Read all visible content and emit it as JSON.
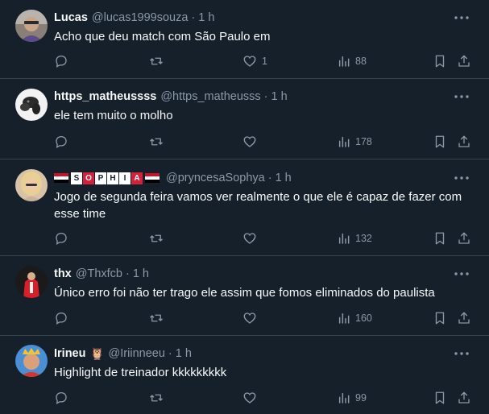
{
  "colors": {
    "background": "#15202b",
    "divider": "#38444d",
    "text_primary": "#f7f9f9",
    "text_secondary": "#8b98a5"
  },
  "tweets": [
    {
      "display_name": "Lucas",
      "handle": "@lucas1999souza",
      "separator": "·",
      "time": "1 h",
      "text": "Acho que deu match com São Paulo em",
      "reply_count": "",
      "retweet_count": "",
      "like_count": "1",
      "view_count": "88"
    },
    {
      "display_name": "https_matheussss",
      "handle": "@https_matheusss",
      "separator": "·",
      "time": "1 h",
      "text": "ele tem muito o molho",
      "reply_count": "",
      "retweet_count": "",
      "like_count": "",
      "view_count": "178"
    },
    {
      "display_name": "SOPHIA",
      "display_name_letters": [
        "S",
        "O",
        "P",
        "H",
        "I",
        "A"
      ],
      "handle": "@pryncesaSophya",
      "separator": "·",
      "time": "1 h",
      "text": "Jogo de segunda feira vamos ver realmente o que ele é capaz de fazer com esse time",
      "reply_count": "",
      "retweet_count": "",
      "like_count": "",
      "view_count": "132"
    },
    {
      "display_name": "thx",
      "handle": "@Thxfcb",
      "separator": "·",
      "time": "1 h",
      "text": "Único erro foi não ter trago ele assim que fomos eliminados do paulista",
      "reply_count": "",
      "retweet_count": "",
      "like_count": "",
      "view_count": "160"
    },
    {
      "display_name": "Irineu",
      "name_emoji": "🦉",
      "handle": "@Iriinneeu",
      "separator": "·",
      "time": "1 h",
      "text": "Highlight de treinador kkkkkkkkk",
      "reply_count": "",
      "retweet_count": "",
      "like_count": "",
      "view_count": "99"
    }
  ],
  "icons": {
    "more": "more-horizontal-icon",
    "reply": "reply-icon",
    "retweet": "retweet-icon",
    "like": "heart-icon",
    "views": "views-chart-icon",
    "bookmark": "bookmark-icon",
    "share": "share-icon"
  }
}
